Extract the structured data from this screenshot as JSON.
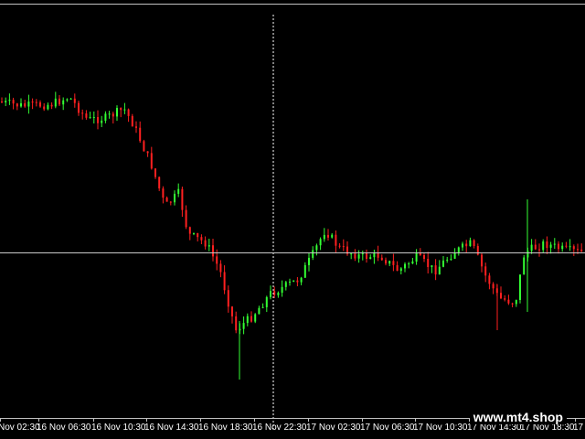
{
  "time_axis": {
    "labels": [
      "Nov 02:30",
      "16 Nov 06:30",
      "16 Nov 10:30",
      "16 Nov 14:30",
      "16 Nov 18:30",
      "16 Nov 22:30",
      "17 Nov 02:30",
      "17 Nov 06:30",
      "17 Nov 10:30",
      "17 Nov 14:30",
      "17 Nov 18:30",
      "17"
    ]
  },
  "watermark": "www.mt4.shop",
  "colors": {
    "background": "#000000",
    "bull_candle": "#33ff33",
    "bear_candle": "#ff2020",
    "crosshair": "#ffffff",
    "axis": "#c0c0c0"
  },
  "crosshair": {
    "visible": true,
    "style": "vertical dashed, horizontal solid"
  },
  "chart_data": {
    "type": "candlestick",
    "symbol": "",
    "timeframe": "",
    "bars_visible": 150,
    "trend_summary": [
      {
        "segment": "16 Nov 02:30 - 16 Nov 10:30",
        "direction": "sideways"
      },
      {
        "segment": "16 Nov 10:30 - 16 Nov 18:30",
        "direction": "down"
      },
      {
        "segment": "16 Nov 18:30 - 17 Nov 02:30",
        "direction": "up"
      },
      {
        "segment": "17 Nov 02:30 - 17 Nov 18:30",
        "direction": "sideways"
      }
    ]
  }
}
